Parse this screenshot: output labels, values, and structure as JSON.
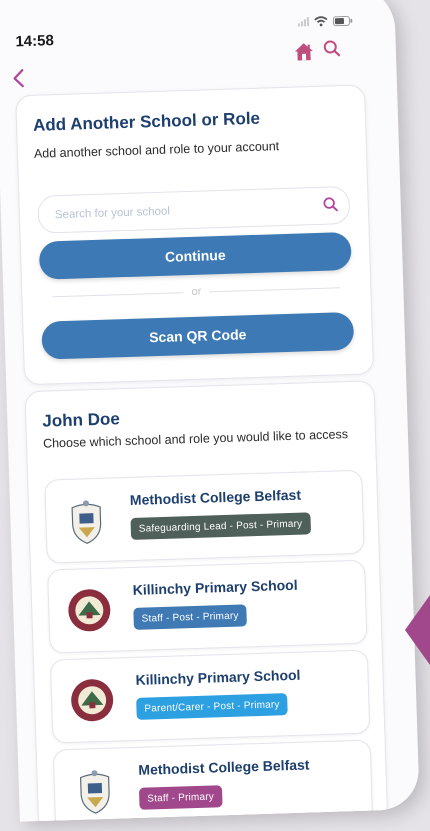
{
  "status": {
    "time": "14:58"
  },
  "add_card": {
    "title": "Add Another School or Role",
    "subtitle": "Add another school and role to your account",
    "search_placeholder": "Search for your school",
    "continue_label": "Continue",
    "or_label": "or",
    "scan_label": "Scan QR Code"
  },
  "user_card": {
    "name": "John Doe",
    "prompt": "Choose which school and role you would like to access",
    "schools": [
      {
        "name": "Methodist College Belfast",
        "role": "Safeguarding Lead - Post - Primary",
        "role_color": "#4f5f59",
        "crest": "mcb"
      },
      {
        "name": "Killinchy Primary School",
        "role": "Staff - Post - Primary",
        "role_color": "#3f7ab5",
        "crest": "killinchy"
      },
      {
        "name": "Killinchy Primary School",
        "role": "Parent/Carer - Post - Primary",
        "role_color": "#2ca0e0",
        "crest": "killinchy"
      },
      {
        "name": "Methodist College Belfast",
        "role": "Staff - Primary",
        "role_color": "#a0488b",
        "crest": "mcb"
      }
    ]
  },
  "colors": {
    "primary": "#3d7ab5",
    "title": "#1d3f6e",
    "home_icon": "#c04f7e",
    "accent_tab": "#a0488b"
  }
}
